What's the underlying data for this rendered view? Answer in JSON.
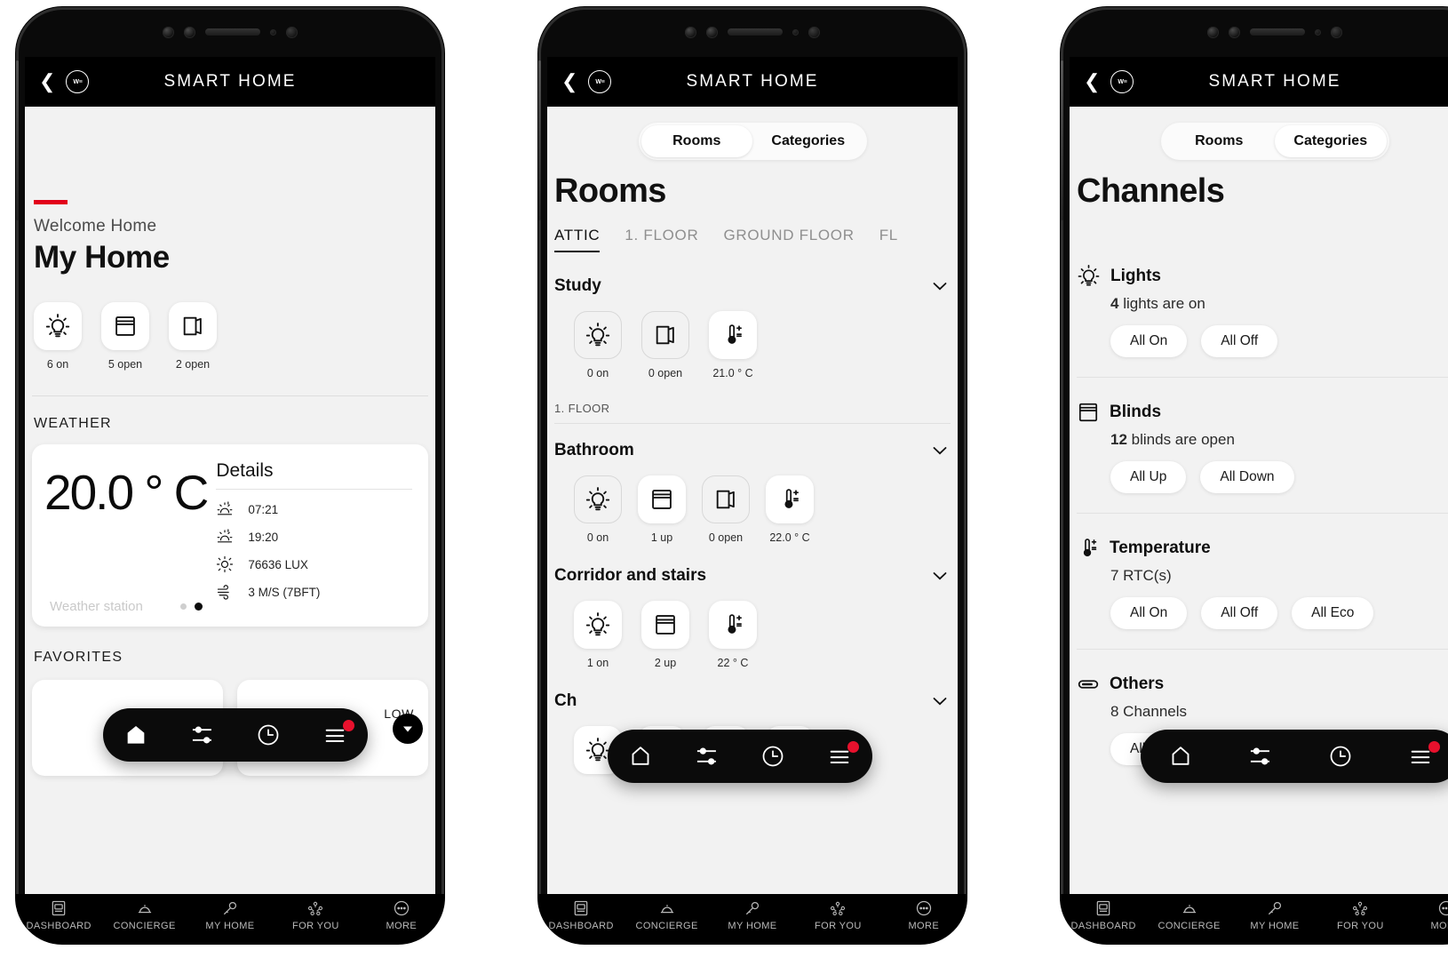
{
  "app": {
    "header_title": "SMART HOME",
    "logo_text": "W≡",
    "back_icon": "chevron-left-icon"
  },
  "system_nav": [
    {
      "label": "DASHBOARD",
      "icon": "dashboard-icon"
    },
    {
      "label": "CONCIERGE",
      "icon": "concierge-bell-icon"
    },
    {
      "label": "MY HOME",
      "icon": "key-icon"
    },
    {
      "label": "FOR YOU",
      "icon": "for-you-icon"
    },
    {
      "label": "MORE",
      "icon": "more-dots-icon"
    }
  ],
  "pill_nav": [
    {
      "icon": "home-icon",
      "name": "home",
      "active": true
    },
    {
      "icon": "sliders-icon",
      "name": "controls",
      "active": false
    },
    {
      "icon": "clock-icon",
      "name": "schedule",
      "active": false
    },
    {
      "icon": "list-icon",
      "name": "notifications",
      "active": false,
      "badge": true
    }
  ],
  "accent_color": "#e2001a",
  "badge_color": "#e8112d",
  "screen_bg": "#f2f2f2",
  "phone1": {
    "welcome": "Welcome Home",
    "home_name": "My Home",
    "summary": [
      {
        "icon": "lightbulb-icon",
        "caption": "6 on",
        "active": true
      },
      {
        "icon": "blinds-icon",
        "caption": "5 open",
        "active": true
      },
      {
        "icon": "door-icon",
        "caption": "2 open",
        "active": true
      }
    ],
    "weather_section_title": "WEATHER",
    "weather": {
      "temperature": "20.0 ° C",
      "details_title": "Details",
      "rows": [
        {
          "icon": "sunrise-icon",
          "value": "07:21"
        },
        {
          "icon": "sunset-icon",
          "value": "19:20"
        },
        {
          "icon": "sun-icon",
          "value": "76636 LUX"
        },
        {
          "icon": "wind-icon",
          "value": "3 M/S (7BFT)"
        }
      ],
      "source": "Weather station",
      "page_dots": 2,
      "active_dot": 1
    },
    "favorites_title": "FAVORITES",
    "favorites": [
      {
        "label": ""
      },
      {
        "label": "LOW"
      }
    ],
    "scroll_down_icon": "triangle-down-icon"
  },
  "phone2": {
    "segments": [
      {
        "label": "Rooms",
        "active": true
      },
      {
        "label": "Categories",
        "active": false
      }
    ],
    "page_title": "Rooms",
    "floor_tabs": [
      {
        "label": "ATTIC",
        "active": true
      },
      {
        "label": "1. FLOOR",
        "active": false
      },
      {
        "label": "GROUND FLOOR",
        "active": false
      },
      {
        "label": "FL",
        "active": false
      }
    ],
    "floor_divider_label": "1. FLOOR",
    "rooms": [
      {
        "name": "Study",
        "chevron": "chevron-down-icon",
        "items": [
          {
            "icon": "lightbulb-icon",
            "caption": "0 on",
            "active": false
          },
          {
            "icon": "door-icon",
            "caption": "0 open",
            "active": false
          },
          {
            "icon": "thermostat-icon",
            "caption": "21.0 ° C",
            "active": true
          }
        ]
      },
      {
        "name": "Bathroom",
        "chevron": "chevron-down-icon",
        "items": [
          {
            "icon": "lightbulb-icon",
            "caption": "0 on",
            "active": false
          },
          {
            "icon": "blinds-icon",
            "caption": "1 up",
            "active": true
          },
          {
            "icon": "door-icon",
            "caption": "0 open",
            "active": false
          },
          {
            "icon": "thermostat-icon",
            "caption": "22.0 ° C",
            "active": true
          }
        ]
      },
      {
        "name": "Corridor and stairs",
        "chevron": "chevron-down-icon",
        "items": [
          {
            "icon": "lightbulb-icon",
            "caption": "1 on",
            "active": true
          },
          {
            "icon": "blinds-icon",
            "caption": "2 up",
            "active": true
          },
          {
            "icon": "thermostat-icon",
            "caption": "22 ° C",
            "active": true
          }
        ]
      },
      {
        "name": "Ch",
        "chevron": "chevron-down-icon",
        "items": [
          {
            "icon": "lightbulb-icon",
            "caption": "",
            "active": true
          },
          {
            "icon": "blinds-icon",
            "caption": "",
            "active": true
          },
          {
            "icon": "door-icon",
            "caption": "",
            "active": true
          },
          {
            "icon": "thermostat-icon",
            "caption": "",
            "active": true
          }
        ]
      }
    ]
  },
  "phone3": {
    "segments": [
      {
        "label": "Rooms",
        "active": false
      },
      {
        "label": "Categories",
        "active": true
      }
    ],
    "page_title": "Channels",
    "channels": [
      {
        "icon": "lightbulb-icon",
        "name": "Lights",
        "count": "4",
        "sub": " lights are on",
        "buttons": [
          "All On",
          "All Off"
        ]
      },
      {
        "icon": "blinds-icon",
        "name": "Blinds",
        "count": "12",
        "sub": " blinds are open",
        "buttons": [
          "All Up",
          "All Down"
        ]
      },
      {
        "icon": "thermostat-icon",
        "name": "Temperature",
        "count": "",
        "sub": "7 RTC(s)",
        "buttons": [
          "All On",
          "All Off",
          "All Eco"
        ]
      },
      {
        "icon": "switch-icon",
        "name": "Others",
        "count": "",
        "sub": "8 Channels",
        "buttons": [
          "All On"
        ]
      }
    ]
  }
}
